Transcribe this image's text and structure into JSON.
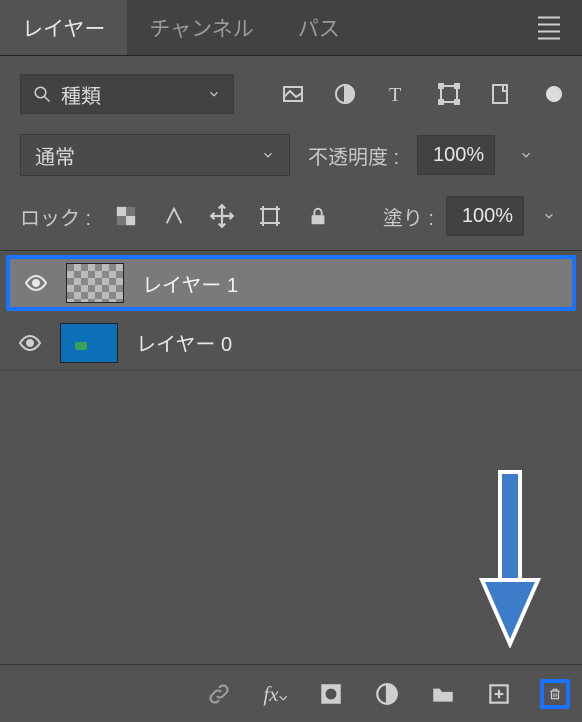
{
  "tabs": {
    "layers": "レイヤー",
    "channels": "チャンネル",
    "paths": "パス"
  },
  "filter": {
    "kind": "種類"
  },
  "blend": {
    "mode": "通常",
    "opacity_label": "不透明度 :",
    "opacity_value": "100%"
  },
  "lock": {
    "label": "ロック :",
    "fill_label": "塗り :",
    "fill_value": "100%"
  },
  "layers": [
    {
      "name": "レイヤー 1",
      "selected": true,
      "kind": "transparent"
    },
    {
      "name": "レイヤー 0",
      "selected": false,
      "kind": "image"
    }
  ]
}
